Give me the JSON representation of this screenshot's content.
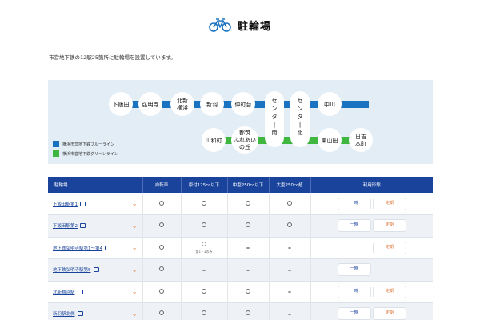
{
  "header": {
    "title": "駐輪場"
  },
  "intro": "市営地下鉄の12駅25箇所に駐輪場を設置しています。",
  "legend": [
    {
      "label": "横浜市営地下鉄ブルーライン",
      "color": "#1a73c0"
    },
    {
      "label": "横浜市営地下鉄グリーンライン",
      "color": "#3fb63f"
    }
  ],
  "stations": {
    "s1": "下飯田",
    "s2": "弘明寺",
    "s3a": "北新",
    "s3b": "横浜",
    "s4": "新羽",
    "s5": "仲町台",
    "s6": "センター南",
    "s7": "センター北",
    "s8": "中川",
    "g1": "川和町",
    "g2a": "都筑",
    "g2b": "ふれあい",
    "g2c": "の丘",
    "g3": "東山田",
    "g4a": "日吉",
    "g4b": "本町"
  },
  "table": {
    "headers": [
      "駐輪場",
      "自転車",
      "原付125cc以下",
      "中型250cc以下",
      "大型250cc超",
      "利用形態"
    ],
    "rows": [
      {
        "name": "下飯田駅第1",
        "c1": "○",
        "c2": "○",
        "c3": "○",
        "c4": "○",
        "note": "",
        "b1": "一時",
        "b2": "定期"
      },
      {
        "name": "下飯田駅第2",
        "c1": "○",
        "c2": "○",
        "c3": "○",
        "c4": "○",
        "note": "",
        "b1": "一時",
        "b2": "定期"
      },
      {
        "name": "地下鉄弘明寺駅第1～第4",
        "c1": "○",
        "c2": "○",
        "c3": "–",
        "c4": "–",
        "note": "第1・3のみ",
        "b1": "",
        "b2": "定期"
      },
      {
        "name": "地下鉄弘明寺駅第5",
        "c1": "○",
        "c2": "–",
        "c3": "–",
        "c4": "–",
        "note": "",
        "b1": "一時",
        "b2": ""
      },
      {
        "name": "北新横浜駅",
        "c1": "○",
        "c2": "○",
        "c3": "○",
        "c4": "–",
        "note": "",
        "b1": "一時",
        "b2": "定期"
      },
      {
        "name": "新羽駅北側",
        "c1": "○",
        "c2": "○",
        "c3": "○",
        "c4": "–",
        "note": "",
        "b1": "一時",
        "b2": "定期"
      }
    ]
  }
}
